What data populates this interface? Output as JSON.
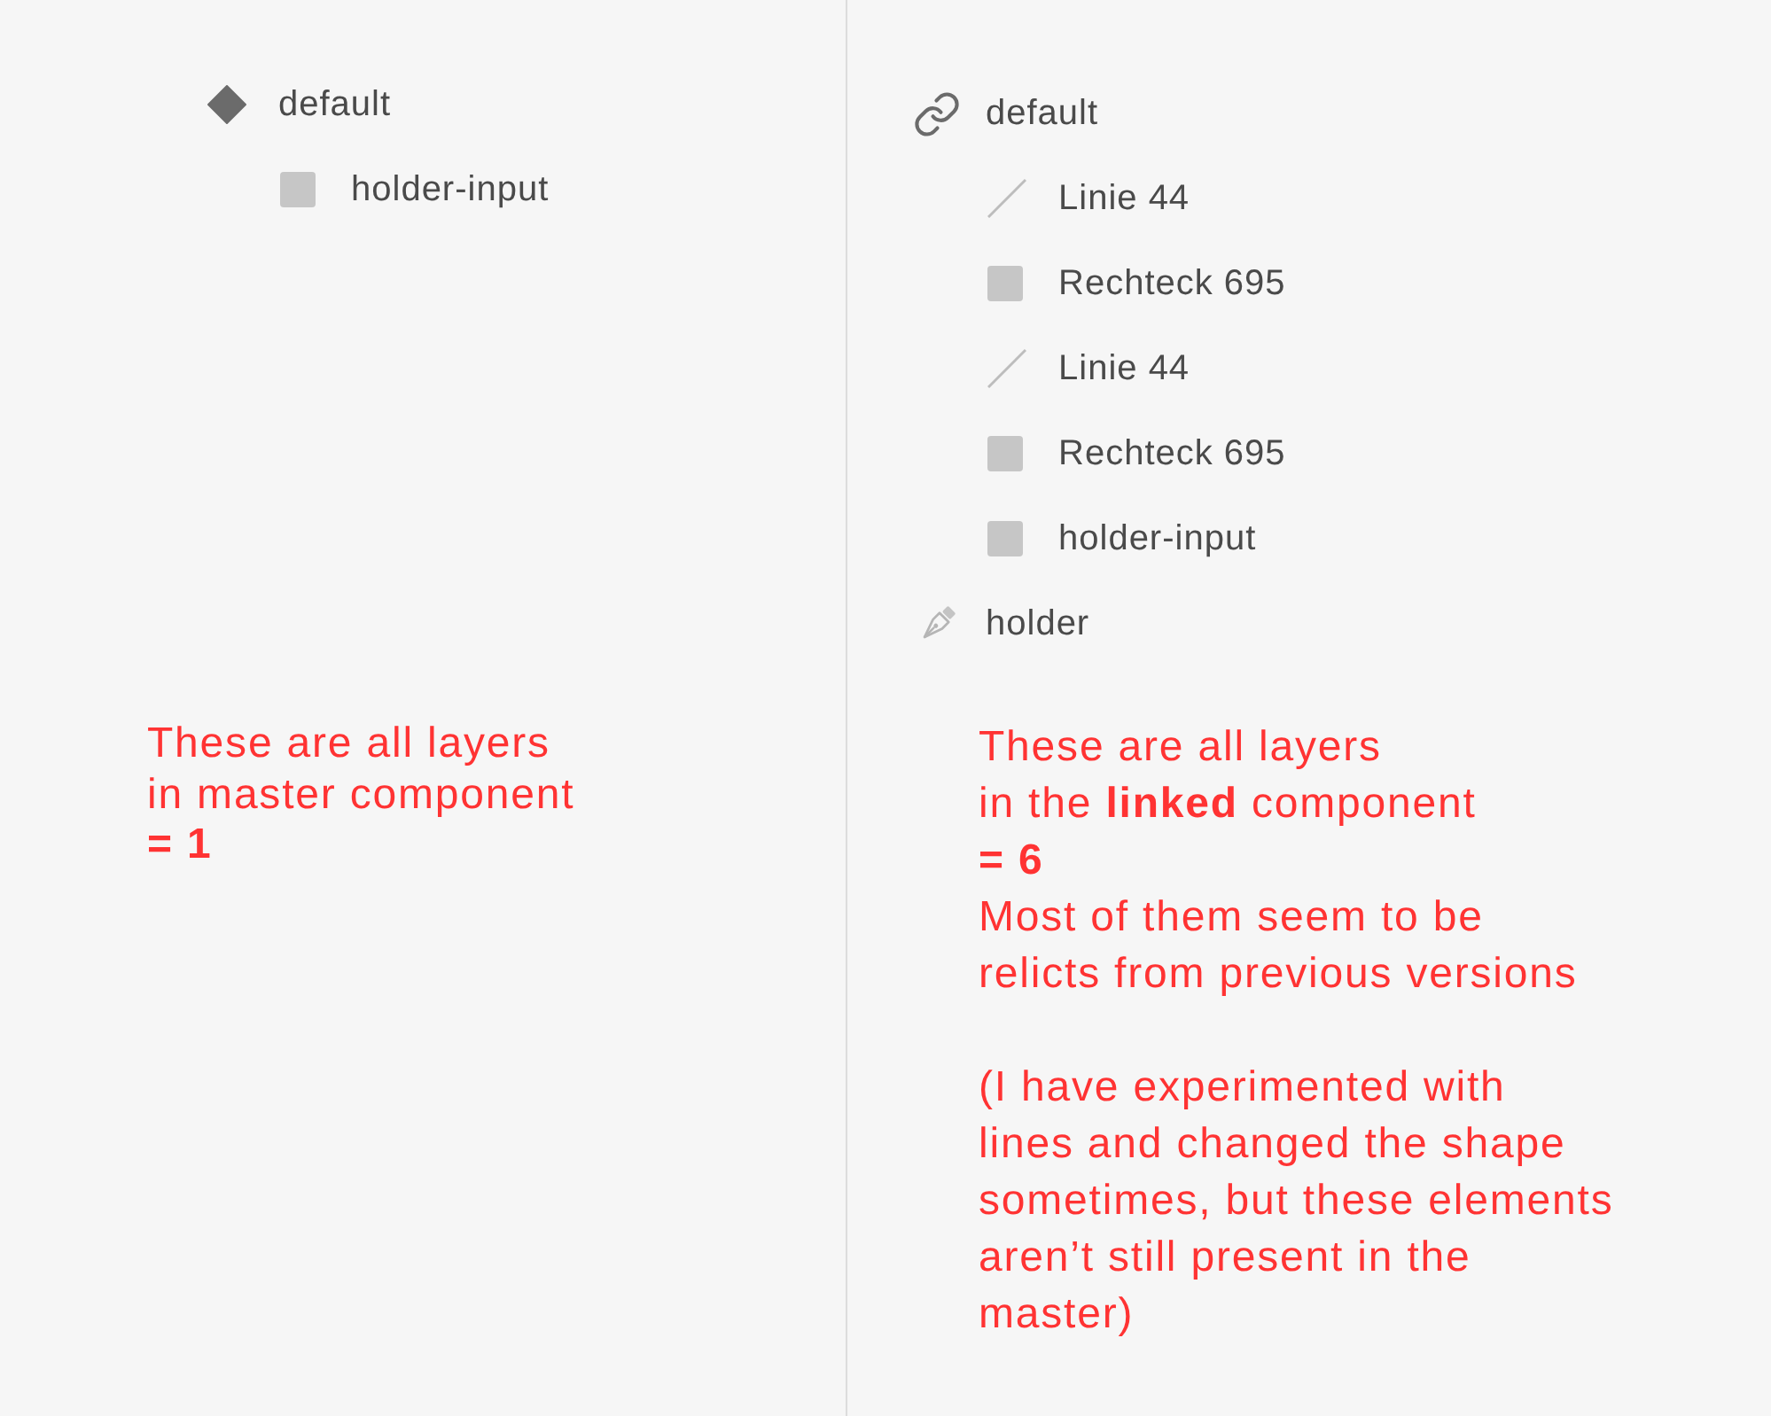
{
  "panels": [
    {
      "layers": [
        {
          "name": "default",
          "kind": "symbol",
          "children": [
            {
              "name": "holder-input",
              "kind": "rectangle"
            }
          ]
        }
      ],
      "note": {
        "paragraphs": [
          [
            "These are all layers",
            "in master component",
            "**= 1**"
          ]
        ]
      }
    },
    {
      "layers": [
        {
          "name": "default",
          "kind": "instance",
          "children": [
            {
              "name": "Linie 44",
              "kind": "line"
            },
            {
              "name": "Rechteck 695",
              "kind": "rectangle"
            },
            {
              "name": "Linie 44",
              "kind": "line"
            },
            {
              "name": "Rechteck 695",
              "kind": "rectangle"
            },
            {
              "name": "holder-input",
              "kind": "rectangle"
            }
          ]
        },
        {
          "name": "holder",
          "kind": "path"
        }
      ],
      "note": {
        "paragraphs": [
          [
            "These are all layers",
            "in the **linked** component",
            "**= 6**",
            "Most of them seem to be",
            "relicts from previous versions"
          ],
          [
            "(I have experimented with",
            "lines and changed the shape",
            "sometimes, but these elements",
            "aren’t still present in the",
            "master)"
          ]
        ]
      }
    }
  ]
}
